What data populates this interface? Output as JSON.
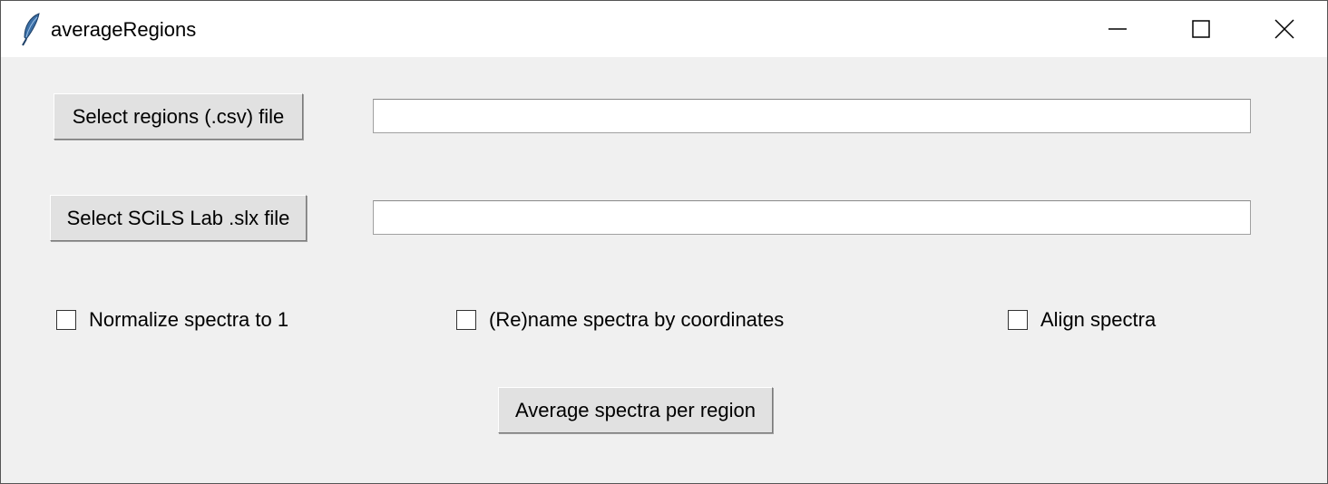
{
  "window": {
    "title": "averageRegions",
    "icon": "feather-icon",
    "controls": [
      "minimize-icon",
      "maximize-icon",
      "close-icon"
    ]
  },
  "form": {
    "regions_button": "Select regions (.csv) file",
    "regions_path": "",
    "slx_button": "Select SCiLS Lab .slx file",
    "slx_path": "",
    "options": [
      {
        "label": "Normalize spectra to 1",
        "checked": false
      },
      {
        "label": "(Re)name spectra by coordinates",
        "checked": false
      },
      {
        "label": "Align spectra",
        "checked": false
      }
    ],
    "run_button": "Average spectra per region"
  }
}
